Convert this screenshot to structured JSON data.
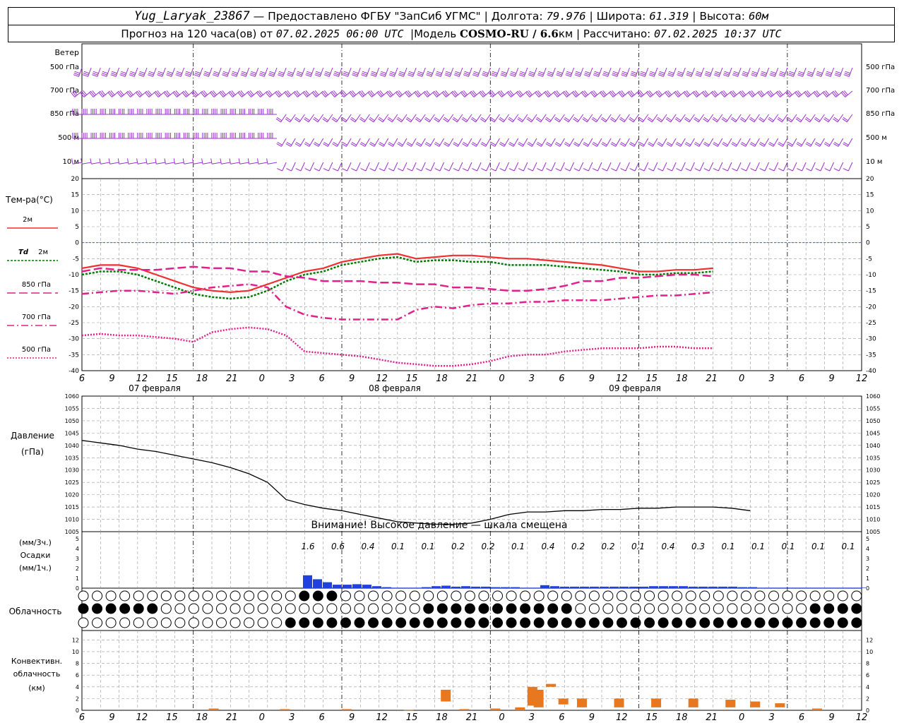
{
  "header": {
    "station": "Yug_Laryak_23867",
    "provider": "— Предоставлено ФГБУ \"ЗапСиб УГМС\"",
    "lon_label": "Долгота:",
    "lon": "79.976",
    "lat_label": "Широта:",
    "lat": "61.319",
    "alt_label": "Высота:",
    "alt": "60м",
    "forecast_label": "Прогноз на 120 часа(ов) от",
    "forecast_time": "07.02.2025 06:00 UTC",
    "model_label": "Модель",
    "model": "COSMO-RU / 6.6",
    "model_unit": "км",
    "calc_label": "Рассчитано:",
    "calc_time": "07.02.2025 10:37 UTC"
  },
  "labels": {
    "wind": "Ветер",
    "wind_levels": [
      "500 гПа",
      "700 гПа",
      "850 гПа",
      "500 м",
      "10 м"
    ],
    "temp": "Тем-ра(°C)",
    "t2m": "2м",
    "td_prefix": "Td",
    "td2m": "2м",
    "t850": "850 гПа",
    "t700": "700 гПа",
    "t500": "500 гПа",
    "pressure": "Давление",
    "pressure_unit": "(гПа)",
    "pressure_warning": "Внимание! Высокое давление — шкала смещена",
    "precip_unit1": "(мм/3ч.)",
    "precip": "Осадки",
    "precip_unit2": "(мм/1ч.)",
    "cloud": "Облачность",
    "conv1": "Конвективн.",
    "conv2": "облачность",
    "conv3": "(км)"
  },
  "colors": {
    "wind": "#9b30d0",
    "t2m": "#f03030",
    "td2m": "#007a00",
    "tlevels": "#e0208c",
    "zero_line": "#2040ff",
    "pressure": "#000000",
    "precip": "#2040e0",
    "conv": "#e87820"
  },
  "chart_data": [
    {
      "type": "line",
      "title": "Тем-ра(°C)",
      "x_hours": [
        0,
        3,
        6,
        9,
        12,
        15,
        18,
        21,
        24,
        27,
        30,
        33,
        36,
        39,
        42,
        45,
        48,
        51,
        54,
        57,
        60,
        63,
        66,
        69,
        72,
        75,
        78,
        81,
        84,
        87,
        90,
        93,
        96,
        99,
        102,
        105,
        108,
        111,
        114,
        117,
        120
      ],
      "ylim": [
        -40,
        20
      ],
      "yticks": [
        -40,
        -35,
        -30,
        -25,
        -20,
        -15,
        -10,
        -5,
        0,
        5,
        10,
        15,
        20
      ],
      "series": [
        {
          "name": "2м",
          "key": "t2m",
          "values": [
            -8,
            -7,
            -7,
            -8,
            -10,
            -12,
            -14,
            -15,
            -15.5,
            -15,
            -13,
            -11,
            -9,
            -8,
            -6,
            -5,
            -4,
            -3.5,
            -5,
            -4.5,
            -4,
            -4,
            -4.5,
            -5,
            -5,
            -5.5,
            -6,
            -6.5,
            -7,
            -8,
            -9,
            -9,
            -8.5,
            -8.5,
            -8
          ]
        },
        {
          "name": "Td 2м",
          "key": "td2m",
          "values": [
            -10,
            -9,
            -9,
            -10,
            -12,
            -14,
            -16,
            -17,
            -17.5,
            -17,
            -15,
            -12,
            -10,
            -9,
            -7,
            -6,
            -5,
            -4.5,
            -6,
            -5.5,
            -5.5,
            -6,
            -6,
            -7,
            -7,
            -7,
            -7.5,
            -8,
            -8.5,
            -9,
            -10,
            -10,
            -9.5,
            -9.5,
            -9
          ]
        },
        {
          "name": "850 гПа",
          "key": "t850",
          "values": [
            -9,
            -8,
            -8.5,
            -8.5,
            -8.5,
            -8,
            -7.5,
            -8,
            -8,
            -9,
            -9,
            -10.5,
            -11,
            -12,
            -12,
            -12,
            -12.5,
            -12.5,
            -13,
            -13,
            -14,
            -14,
            -14.5,
            -15,
            -15,
            -14.5,
            -13.5,
            -12,
            -12,
            -11,
            -11,
            -10.5,
            -10,
            -10,
            -10.5
          ]
        },
        {
          "name": "700 гПа",
          "key": "t700",
          "values": [
            -16,
            -15.5,
            -15,
            -15,
            -15.5,
            -16,
            -15,
            -14,
            -13.5,
            -13,
            -14,
            -20,
            -22.5,
            -23.5,
            -24,
            -24,
            -24,
            -24,
            -21,
            -20,
            -20.5,
            -19.5,
            -19,
            -19,
            -18.5,
            -18.5,
            -18,
            -18,
            -18,
            -17.5,
            -17,
            -16.5,
            -16.5,
            -16,
            -15.5
          ]
        },
        {
          "name": "500 гПа",
          "key": "t500",
          "values": [
            -29,
            -28.5,
            -29,
            -29,
            -29.5,
            -30,
            -31,
            -28,
            -27,
            -26.5,
            -27,
            -29,
            -34,
            -34.5,
            -35,
            -35.5,
            -36.5,
            -37.5,
            -38,
            -38.5,
            -38.5,
            -38,
            -37,
            -35.5,
            -35,
            -35,
            -34,
            -33.5,
            -33,
            -33,
            -33,
            -32.5,
            -32.5,
            -33,
            -33
          ]
        }
      ],
      "x_tick_labels": [
        "6",
        "9",
        "12",
        "15",
        "18",
        "21",
        "0",
        "3",
        "6",
        "9",
        "12",
        "15",
        "18",
        "21",
        "0",
        "3",
        "6",
        "9",
        "12",
        "15",
        "18",
        "21",
        "0",
        "3",
        "6",
        "9",
        "12"
      ],
      "date_labels": [
        "07 февраля",
        "08 февраля",
        "09 февраля"
      ]
    },
    {
      "type": "line",
      "title": "Давление (гПа)",
      "x_hours": [
        0,
        3,
        6,
        9,
        12,
        15,
        18,
        21,
        24,
        27,
        30,
        33,
        36,
        39,
        42,
        45,
        48,
        51,
        54,
        57,
        60,
        63,
        66,
        69,
        72,
        75,
        78,
        81,
        84,
        87,
        90,
        93,
        96,
        99,
        102,
        105,
        108,
        111,
        114
      ],
      "ylim": [
        1005,
        1060
      ],
      "yticks": [
        1005,
        1010,
        1015,
        1020,
        1025,
        1030,
        1035,
        1040,
        1045,
        1050,
        1055,
        1060
      ],
      "series": [
        {
          "name": "Давление",
          "values": [
            1042,
            1041,
            1040,
            1038.5,
            1037.5,
            1036,
            1034.5,
            1033,
            1031,
            1028.5,
            1025,
            1018,
            1016,
            1014.5,
            1013.5,
            1012,
            1010.5,
            1009,
            1008.5,
            1008,
            1008,
            1008.5,
            1010,
            1012,
            1013,
            1013,
            1013.5,
            1013.5,
            1014,
            1014,
            1014.5,
            1014.5,
            1015,
            1015,
            1015,
            1014.5,
            1013.5
          ]
        }
      ]
    },
    {
      "type": "bar",
      "title": "Осадки",
      "labels_3h": [
        "1.6",
        "0.6",
        "0.4",
        "0.1",
        "0.1",
        "0.2",
        "0.2",
        "0.1",
        "0.4",
        "0.2",
        "0.2",
        "0.1",
        "0.4",
        "0.3",
        "0.1",
        "0.1",
        "0.1",
        "0.1",
        "0.1"
      ],
      "ylim": [
        0,
        5
      ],
      "hourly": [
        1.3,
        0.9,
        0.6,
        0.35,
        0.35,
        0.4,
        0.35,
        0.2,
        0.1,
        0.05,
        0.05,
        0.05,
        0.1,
        0.2,
        0.25,
        0.15,
        0.2,
        0.15,
        0.15,
        0.1,
        0.1,
        0.1,
        0.05,
        0.05,
        0.3,
        0.2,
        0.15,
        0.15,
        0.15,
        0.15,
        0.15,
        0.15,
        0.15,
        0.15,
        0.15,
        0.2,
        0.2,
        0.2,
        0.2,
        0.15,
        0.15,
        0.15,
        0.15,
        0.15,
        0.1,
        0.1,
        0.05,
        0.05,
        0.05,
        0.05,
        0.05,
        0.05,
        0.05,
        0.05,
        0.05,
        0.05,
        0.05,
        0.05,
        0.05,
        0.05,
        0.05,
        0.05,
        0.05,
        0.05,
        0.05,
        0.05,
        0.05,
        0.1,
        0.1
      ]
    },
    {
      "type": "bar",
      "title": "Конвективн. облачность (км)",
      "ylim": [
        0,
        13
      ],
      "yticks": [
        0,
        2,
        4,
        6,
        8,
        10,
        12
      ],
      "bars": [
        {
          "h": 20.5,
          "lo": 0,
          "hi": 0.3
        },
        {
          "h": 32,
          "lo": 0,
          "hi": 0.2
        },
        {
          "h": 42,
          "lo": 0,
          "hi": 0.2
        },
        {
          "h": 52,
          "lo": 0,
          "hi": 0.1
        },
        {
          "h": 58,
          "lo": 1.5,
          "hi": 3.5
        },
        {
          "h": 61,
          "lo": 0,
          "hi": 0.2
        },
        {
          "h": 66,
          "lo": 0,
          "hi": 0.3
        },
        {
          "h": 70,
          "lo": 0,
          "hi": 0.5
        },
        {
          "h": 72,
          "lo": 0.8,
          "hi": 4
        },
        {
          "h": 73,
          "lo": 0.5,
          "hi": 3.5
        },
        {
          "h": 75,
          "lo": 4,
          "hi": 4.5
        },
        {
          "h": 77,
          "lo": 1,
          "hi": 2
        },
        {
          "h": 80,
          "lo": 0.5,
          "hi": 2
        },
        {
          "h": 86,
          "lo": 0.5,
          "hi": 2
        },
        {
          "h": 92,
          "lo": 0.5,
          "hi": 2
        },
        {
          "h": 98,
          "lo": 0.5,
          "hi": 2
        },
        {
          "h": 104,
          "lo": 0.5,
          "hi": 1.8
        },
        {
          "h": 108,
          "lo": 0.5,
          "hi": 1.5
        },
        {
          "h": 112,
          "lo": 0.5,
          "hi": 1.2
        },
        {
          "h": 118,
          "lo": 0,
          "hi": 0.3
        }
      ]
    }
  ]
}
